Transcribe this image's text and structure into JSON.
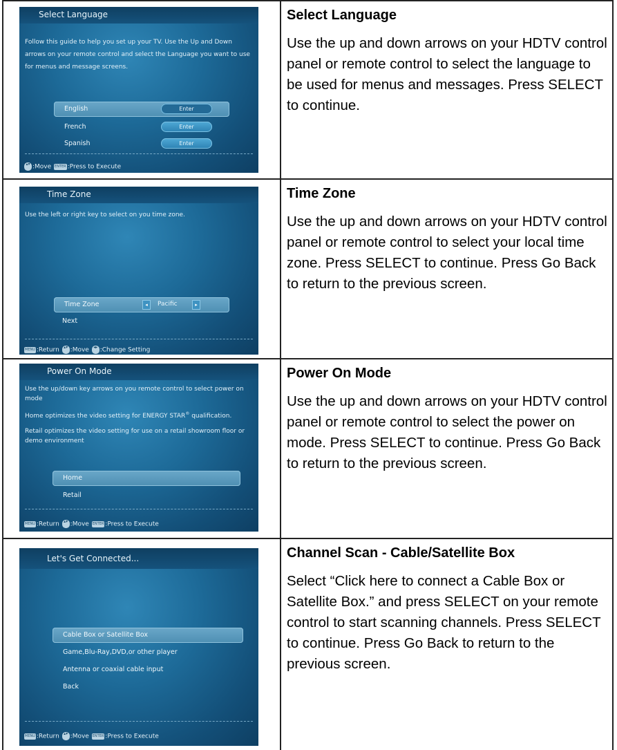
{
  "rows": [
    {
      "tv": {
        "title": "Select Language",
        "intro": "Follow this guide to help you set up your TV. Use the Up and Down arrows on your remote control and select the Language you want to use for menus and message screens.",
        "options": [
          {
            "label": "English",
            "button": "Enter"
          },
          {
            "label": "French",
            "button": "Enter"
          },
          {
            "label": "Spanish",
            "button": "Enter"
          }
        ],
        "footer": {
          "move": ":Move",
          "execute": ":Press to Execute",
          "key_enter": "ENTER"
        }
      },
      "heading": "Select Language",
      "body": "Use the up and down arrows on your HDTV control panel or remote control to select the language to be used for menus and messages. Press SELECT to continue."
    },
    {
      "tv": {
        "title": "Time Zone",
        "intro": "Use the left or right key to select on you time zone.",
        "setting_label": "Time Zone",
        "setting_value": "Pacific",
        "next": "Next",
        "footer": {
          "return": ":Return",
          "move": ":Move",
          "change": ":Change Setting",
          "key_menu": "MENU"
        }
      },
      "heading": "Time Zone",
      "body": "Use the up and down arrows on your HDTV control panel or remote control to select your local time zone. Press SELECT to continue. Press Go Back to return to the previous screen."
    },
    {
      "tv": {
        "title": "Power On Mode",
        "para1": "Use the up/down key arrows on you remote control to select power on mode",
        "para2_prefix": "Home optimizes the video setting for ENERGY STAR",
        "para2_mark": "®",
        "para2_suffix": "qualification.",
        "para3": "Retail optimizes the video setting for use on a retail showroom floor or demo environment",
        "options": [
          "Home",
          "Retail"
        ],
        "footer": {
          "return": ":Return",
          "move": ":Move",
          "execute": ":Press to Execute",
          "key_menu": "MENU",
          "key_enter": "ENTER"
        }
      },
      "heading": "Power On Mode",
      "body": "Use the up and down arrows on your HDTV control panel or remote control to select the power on mode. Press SELECT to continue. Press Go Back to return to the previous screen."
    },
    {
      "tv": {
        "title": "Let's Get Connected...",
        "options": [
          "Cable Box or Satellite Box",
          "Game,Blu-Ray,DVD,or other player",
          "Antenna or coaxial cable input",
          "Back"
        ],
        "footer": {
          "return": ":Return",
          "move": ":Move",
          "execute": ":Press to Execute",
          "key_menu": "MENU",
          "key_enter": "ENTER"
        }
      },
      "heading": "Channel Scan - Cable/Satellite Box",
      "body": "Select “Click here to connect a Cable Box or Satellite Box.” and press SELECT on your remote control to start scanning channels. Press SELECT to continue. Press Go Back to return to the previous screen."
    }
  ]
}
